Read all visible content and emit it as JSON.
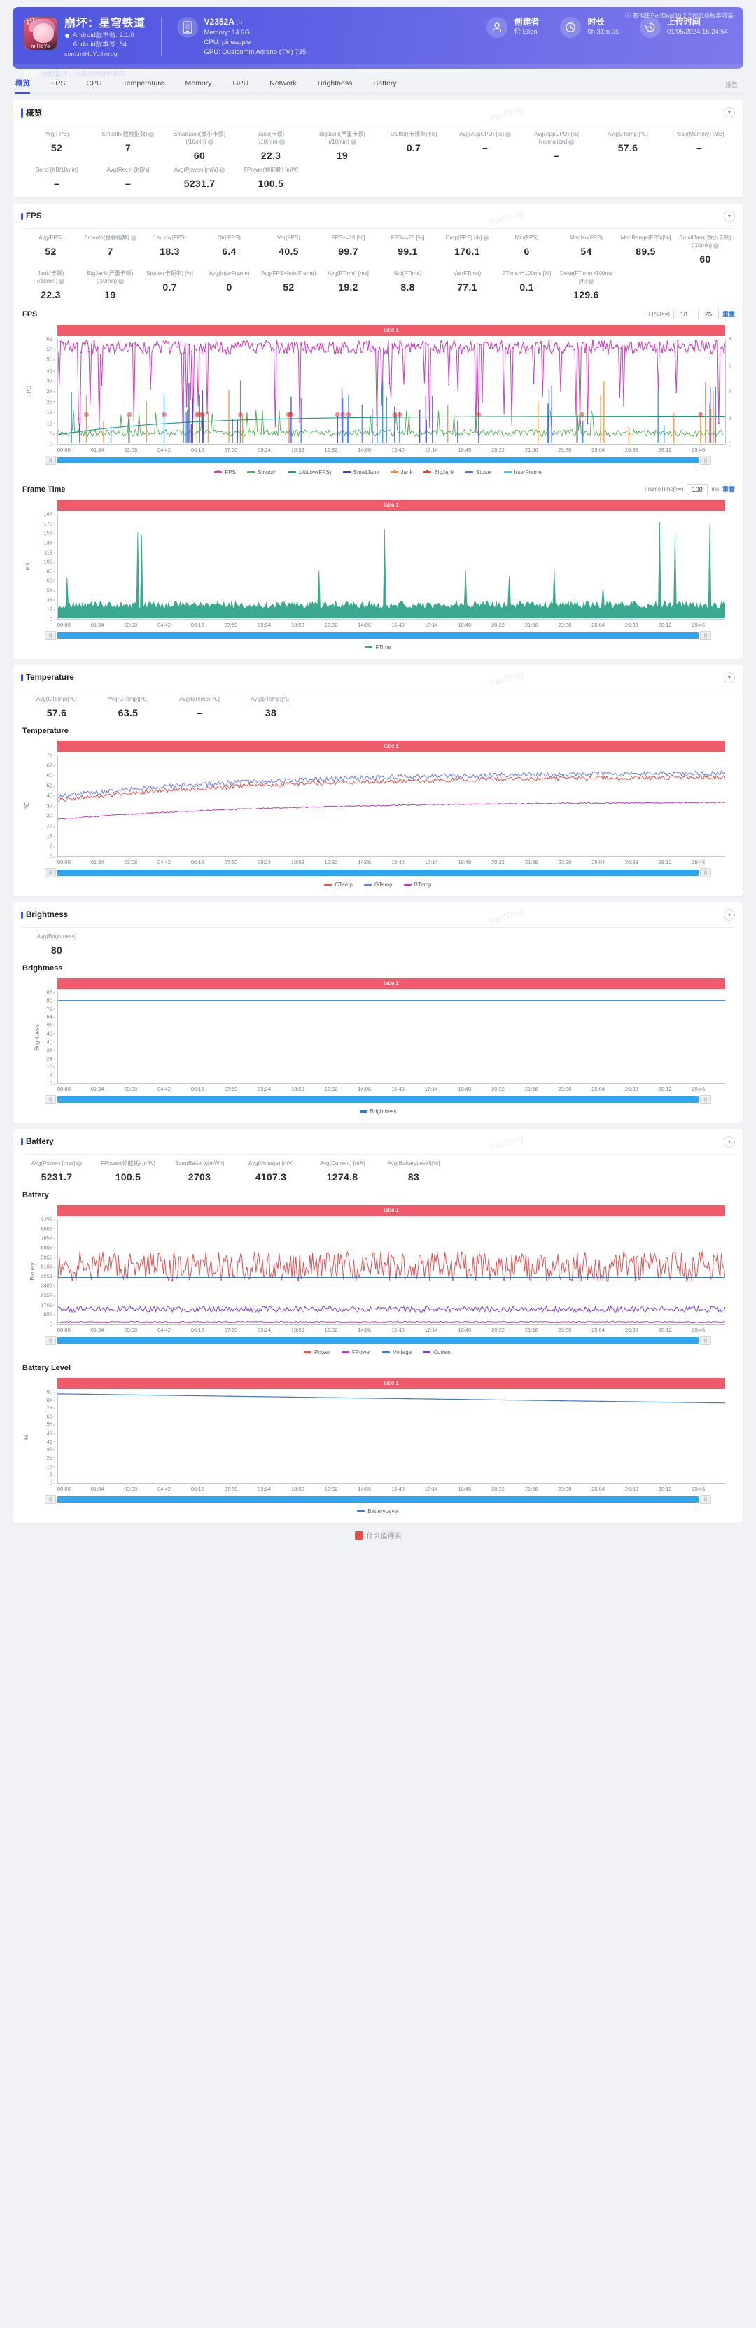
{
  "header": {
    "app_name": "崩坏：星穹铁道",
    "android_version_name": "Android版本名: 2.1.0",
    "android_version_code": "Android版本号: 64",
    "package": "com.miHoYo.hkrpg",
    "device_model": "V2352A",
    "memory": "Memory: 14.9G",
    "cpu": "CPU: pineapple",
    "gpu": "GPU: Qualcomm Adreno (TM) 735",
    "creator_label": "创建者",
    "creator_value": "伦 Ellen",
    "duration_label": "时长",
    "duration_value": "0h 31m 0s",
    "upload_label": "上传时间",
    "upload_value": "01/05/2024 15:24:54",
    "collect_note": "数据由PerfDog(10.2.240316)版本收集",
    "note_label": "备注:",
    "note_placeholder": "添加备注，不超过200个字符"
  },
  "tabs": [
    {
      "label": "概览",
      "active": true
    },
    {
      "label": "FPS",
      "active": false
    },
    {
      "label": "CPU",
      "active": false
    },
    {
      "label": "Temperature",
      "active": false
    },
    {
      "label": "Memory",
      "active": false
    },
    {
      "label": "GPU",
      "active": false
    },
    {
      "label": "Network",
      "active": false
    },
    {
      "label": "Brightness",
      "active": false
    },
    {
      "label": "Battery",
      "active": false
    }
  ],
  "tab_right": "报告",
  "overview": {
    "title": "概览",
    "metrics_row1": [
      {
        "label": "Avg(FPS)",
        "value": "52",
        "help": false
      },
      {
        "label": "Smooth(稳帧指数)",
        "value": "7",
        "help": true
      },
      {
        "label": "SmallJank(微小卡顿)\n(/10min)",
        "value": "60",
        "help": true
      },
      {
        "label": "Jank(卡顿)\n(/10min)",
        "value": "22.3",
        "help": true
      },
      {
        "label": "BigJank(严重卡顿)\n(/10min)",
        "value": "19",
        "help": true
      },
      {
        "label": "Stutter(卡顿率) [%]",
        "value": "0.7",
        "help": false
      },
      {
        "label": "Avg(AppCPU) [%]",
        "value": "–",
        "help": true
      },
      {
        "label": "Avg(AppCPU) [%]\nNormalized",
        "value": "–",
        "help": true
      },
      {
        "label": "Avg(CTemp)[℃]",
        "value": "57.6",
        "help": false
      },
      {
        "label": "Peak(Memory) [MB]",
        "value": "–",
        "help": false
      }
    ],
    "metrics_row2": [
      {
        "label": "Send [KB/10min]",
        "value": "–",
        "help": false
      },
      {
        "label": "Avg(Recv) [KB/s]",
        "value": "–",
        "help": false
      },
      {
        "label": "Avg(Power) [mW]",
        "value": "5231.7",
        "help": true
      },
      {
        "label": "FPower(帧能耗) [mW]",
        "value": "100.5",
        "help": false
      }
    ]
  },
  "fps_section": {
    "title": "FPS",
    "metrics_row1": [
      {
        "label": "Avg(FPS)",
        "value": "52",
        "help": false
      },
      {
        "label": "Smooth(稳帧指数)",
        "value": "7",
        "help": true
      },
      {
        "label": "1%Low(FPS)",
        "value": "18.3",
        "help": false
      },
      {
        "label": "Std(FPS)",
        "value": "6.4",
        "help": false
      },
      {
        "label": "Var(FPS)",
        "value": "40.5",
        "help": false
      },
      {
        "label": "FPS>=18 [%]",
        "value": "99.7",
        "help": false
      },
      {
        "label": "FPS>=25 [%]",
        "value": "99.1",
        "help": false
      },
      {
        "label": "Drop(FPS) [/h]",
        "value": "176.1",
        "help": true
      },
      {
        "label": "Min(FPS)",
        "value": "6",
        "help": false
      },
      {
        "label": "Median(FPS)",
        "value": "54",
        "help": false
      },
      {
        "label": "MedRange(FPS)[%]",
        "value": "89.5",
        "help": false
      },
      {
        "label": "SmallJank(微小卡顿)\n(/10min)",
        "value": "60",
        "help": true
      }
    ],
    "metrics_row2": [
      {
        "label": "Jank(卡顿)\n(/10min)",
        "value": "22.3",
        "help": true
      },
      {
        "label": "BigJank(严重卡顿)\n(/10min)",
        "value": "19",
        "help": true
      },
      {
        "label": "Stutter(卡顿率) [%]",
        "value": "0.7",
        "help": false
      },
      {
        "label": "Avg(InterFrame)",
        "value": "0",
        "help": false
      },
      {
        "label": "Avg(FPS+InterFrame)",
        "value": "52",
        "help": false
      },
      {
        "label": "Avg(FTime) [ms]",
        "value": "19.2",
        "help": false
      },
      {
        "label": "Std(FTime)",
        "value": "8.8",
        "help": false
      },
      {
        "label": "Var(FTime)",
        "value": "77.1",
        "help": false
      },
      {
        "label": "FTime>=100ms [%]",
        "value": "0.1",
        "help": false
      },
      {
        "label": "Delta(FTime)>100ms [/h]",
        "value": "129.6",
        "help": true
      }
    ]
  },
  "temperature_section": {
    "title": "Temperature",
    "metrics": [
      {
        "label": "Avg(CTemp)[℃]",
        "value": "57.6",
        "help": false
      },
      {
        "label": "Avg(GTemp)[℃]",
        "value": "63.5",
        "help": false
      },
      {
        "label": "Avg(NTemp)[℃]",
        "value": "–",
        "help": false
      },
      {
        "label": "Avg(BTemp)[℃]",
        "value": "38",
        "help": false
      }
    ]
  },
  "brightness_section": {
    "title": "Brightness",
    "metrics": [
      {
        "label": "Avg(Brightness)",
        "value": "80",
        "help": false
      }
    ]
  },
  "battery_section": {
    "title": "Battery",
    "metrics": [
      {
        "label": "Avg(Power) [mW]",
        "value": "5231.7",
        "help": true
      },
      {
        "label": "FPower(帧能耗) [mW]",
        "value": "100.5",
        "help": false
      },
      {
        "label": "Sum(Battery)[mWh]",
        "value": "2703",
        "help": false
      },
      {
        "label": "Avg(Voltage) [mV]",
        "value": "4107.3",
        "help": false
      },
      {
        "label": "Avg(Current) [mA]",
        "value": "1274.8",
        "help": false
      },
      {
        "label": "Avg(BatteryLevel)[%]",
        "value": "83",
        "help": false
      }
    ]
  },
  "common": {
    "label_bar": "label1",
    "x_ticks": [
      "00:00",
      "01:34",
      "03:08",
      "04:42",
      "06:16",
      "07:50",
      "09:24",
      "10:58",
      "12:32",
      "14:06",
      "15:40",
      "17:14",
      "18:48",
      "20:22",
      "21:56",
      "23:30",
      "25:04",
      "26:38",
      "28:12",
      "29:46"
    ],
    "reset": "重置",
    "watermark": "PerfDog"
  },
  "chart_data": [
    {
      "id": "fps-chart",
      "type": "line",
      "title": "FPS",
      "ylabel": "FPS",
      "xlabel": "",
      "y_ticks": [
        0,
        6,
        12,
        19,
        25,
        31,
        37,
        43,
        50,
        56,
        62
      ],
      "ylim": [
        0,
        62
      ],
      "y2_ticks": [
        0,
        1,
        2,
        3,
        4
      ],
      "y2lim": [
        0,
        4
      ],
      "ctrl_label": "FPS(>=)",
      "ctrl_values": [
        "18",
        "25"
      ],
      "legend_position": "bottom",
      "legend": [
        {
          "name": "FPS",
          "color": "#cc3fbe",
          "marker": "dot"
        },
        {
          "name": "Smooth",
          "color": "#4caf50",
          "marker": "line"
        },
        {
          "name": "1%Low(FPS)",
          "color": "#129a8a",
          "marker": "line"
        },
        {
          "name": "SmallJank",
          "color": "#3b3bd6",
          "marker": "line"
        },
        {
          "name": "Jank",
          "color": "#f08c2e",
          "marker": "dot"
        },
        {
          "name": "BigJank",
          "color": "#e53935",
          "marker": "dot"
        },
        {
          "name": "Stutter",
          "color": "#2f7ef0",
          "marker": "line"
        },
        {
          "name": "InterFrame",
          "color": "#2fd0e0",
          "marker": "line"
        }
      ],
      "series": [
        {
          "name": "FPS",
          "color": "#cc3fbe",
          "avg": 52,
          "min": 6,
          "max": 62,
          "median": 54
        },
        {
          "name": "Smooth",
          "color": "#4caf50",
          "avg": 7
        },
        {
          "name": "1%Low(FPS)",
          "color": "#129a8a",
          "avg": 18.3
        },
        {
          "name": "InterFrame",
          "color": "#2fd0e0",
          "avg": 0
        }
      ]
    },
    {
      "id": "frametime-chart",
      "type": "area",
      "title": "Frame Time",
      "ylabel": "ms",
      "y_ticks": [
        0,
        17,
        34,
        51,
        68,
        85,
        102,
        119,
        136,
        153,
        170,
        187
      ],
      "ylim": [
        0,
        187
      ],
      "ctrl_label": "FrameTime(>=)",
      "ctrl_values": [
        "100"
      ],
      "ctrl_unit": "ms",
      "legend_position": "bottom",
      "legend": [
        {
          "name": "FTime",
          "color": "#3aa98f",
          "marker": "line"
        }
      ],
      "series": [
        {
          "name": "FTime",
          "color": "#3aa98f",
          "avg": 19.2,
          "max": 187
        }
      ]
    },
    {
      "id": "temperature-chart",
      "type": "line",
      "title": "Temperature",
      "ylabel": "℃",
      "y_ticks": [
        0,
        7,
        15,
        22,
        30,
        37,
        45,
        52,
        60,
        67,
        75
      ],
      "ylim": [
        0,
        75
      ],
      "legend_position": "bottom",
      "legend": [
        {
          "name": "CTemp",
          "color": "#e05252",
          "marker": "line"
        },
        {
          "name": "GTemp",
          "color": "#6a7fe0",
          "marker": "line"
        },
        {
          "name": "BTemp",
          "color": "#b03fbe",
          "marker": "line"
        }
      ],
      "series": [
        {
          "name": "CTemp",
          "color": "#e05252",
          "avg": 57.6
        },
        {
          "name": "GTemp",
          "color": "#6a7fe0",
          "avg": 63.5
        },
        {
          "name": "BTemp",
          "color": "#b03fbe",
          "avg": 38
        }
      ]
    },
    {
      "id": "brightness-chart",
      "type": "line",
      "title": "Brightness",
      "ylabel": "Brightness",
      "y_ticks": [
        0,
        8,
        16,
        24,
        32,
        40,
        48,
        56,
        64,
        72,
        80,
        88
      ],
      "ylim": [
        0,
        88
      ],
      "legend_position": "bottom",
      "legend": [
        {
          "name": "Brightness",
          "color": "#3a78d8",
          "marker": "line"
        }
      ],
      "series": [
        {
          "name": "Brightness",
          "color": "#3a78d8",
          "avg": 80
        }
      ]
    },
    {
      "id": "battery-chart",
      "type": "line",
      "title": "Battery",
      "ylabel": "Battery",
      "y_ticks": [
        0,
        851,
        1702,
        2552,
        3403,
        4254,
        5105,
        5956,
        6806,
        7657,
        8508,
        9359
      ],
      "ylim": [
        0,
        9359
      ],
      "legend_position": "bottom",
      "legend": [
        {
          "name": "Power",
          "color": "#e05252",
          "marker": "line"
        },
        {
          "name": "FPower",
          "color": "#b03fbe",
          "marker": "line"
        },
        {
          "name": "Voltage",
          "color": "#3a78d8",
          "marker": "line"
        },
        {
          "name": "Current",
          "color": "#7b3fd8",
          "marker": "line"
        }
      ],
      "series": [
        {
          "name": "Power",
          "color": "#e05252",
          "avg": 5231.7
        },
        {
          "name": "FPower",
          "color": "#b03fbe",
          "avg": 100.5
        },
        {
          "name": "Voltage",
          "color": "#3a78d8",
          "avg": 4107.3
        },
        {
          "name": "Current",
          "color": "#7b3fd8",
          "avg": 1274.8
        }
      ]
    },
    {
      "id": "batterylevel-chart",
      "type": "line",
      "title": "Battery Level",
      "ylabel": "%",
      "y_ticks": [
        0,
        8,
        16,
        25,
        33,
        41,
        49,
        58,
        66,
        74,
        82,
        90
      ],
      "ylim": [
        0,
        90
      ],
      "legend_position": "bottom",
      "legend": [
        {
          "name": "BatteryLevel",
          "color": "#3a78d8",
          "marker": "line"
        }
      ],
      "series": [
        {
          "name": "BatteryLevel",
          "color": "#3a78d8",
          "avg": 83,
          "start": 88,
          "end": 79
        }
      ]
    }
  ],
  "footer": {
    "text": "什么值得买"
  }
}
